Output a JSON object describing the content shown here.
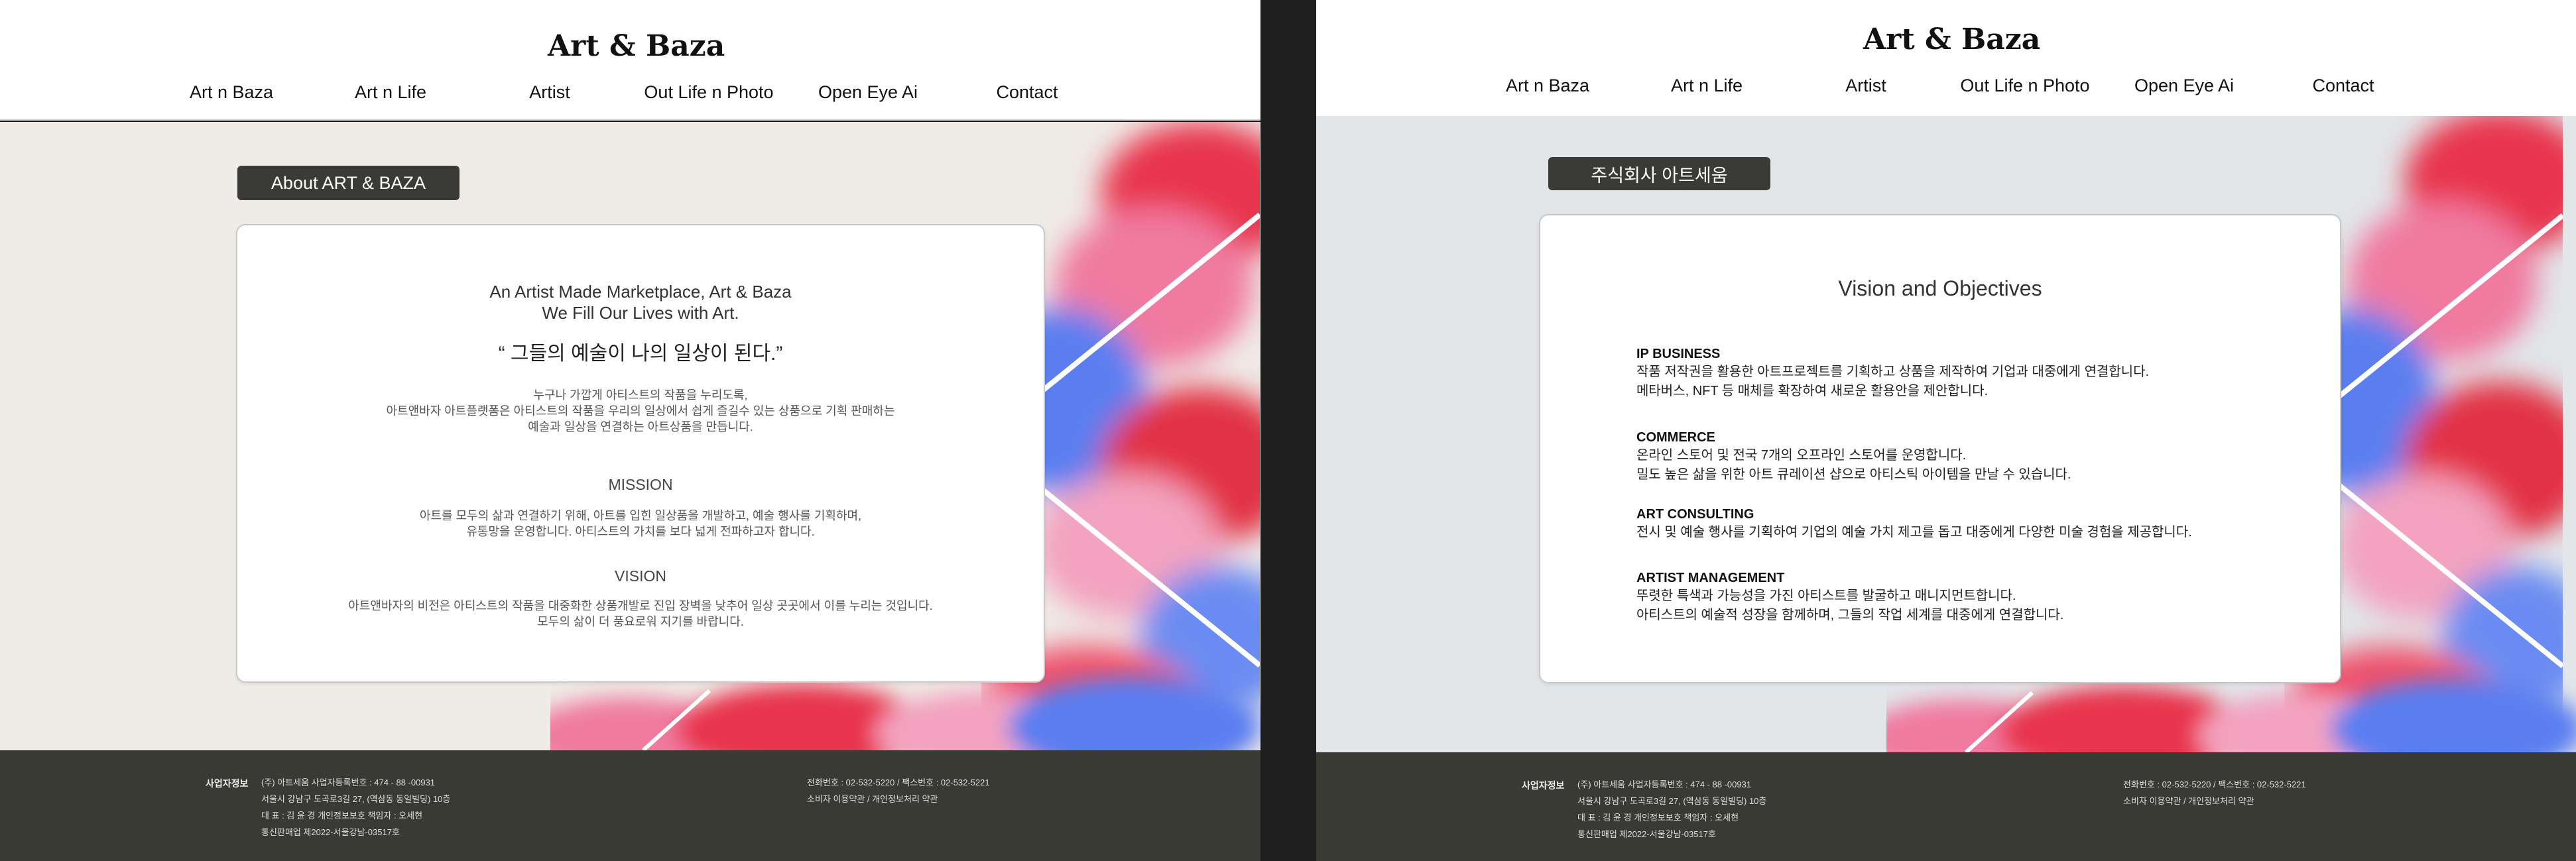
{
  "site": {
    "logo": "Art & Baza",
    "nav": [
      "Art n Baza",
      "Art n Life",
      "Artist",
      "Out Life n Photo",
      "Open Eye Ai",
      "Contact"
    ]
  },
  "left_page": {
    "badge": "About  ART & BAZA",
    "tagline": [
      "An Artist Made Marketplace, Art & Baza",
      "We Fill Our Lives with Art."
    ],
    "quote": "“ 그들의 예술이 나의 일상이 된다.”",
    "intro": [
      "누구나 가깝게 아티스트의 작품을 누리도록,",
      "아트앤바자 아트플랫폼은 아티스트의 작품을 우리의 일상에서 쉽게 즐길수 있는 상품으로 기획 판매하는",
      "예술과 일상을 연결하는 아트상품을 만듭니다."
    ],
    "mission_heading": "MISSION",
    "mission_text": [
      "아트를 모두의 삶과 연결하기 위해, 아트를 입힌 일상품을 개발하고, 예술 행사를 기획하며,",
      "유통망을 운영합니다. 아티스트의 가치를 보다 넓게 전파하고자 합니다."
    ],
    "vision_heading": "VISION",
    "vision_text": [
      "아트앤바자의 비전은 아티스트의 작품을 대중화한 상품개발로  진입 장벽을 낮추어 일상 곳곳에서 이를 누리는 것입니다.",
      "모두의 삶이 더 풍요로워 지기를 바랍니다."
    ]
  },
  "right_page": {
    "badge": "주식회사 아트세움",
    "title": "Vision and Objectives",
    "items": [
      {
        "title": "IP BUSINESS",
        "lines": [
          "작품 저작권을 활용한 아트프로젝트를 기획하고 상품을 제작하여 기업과 대중에게 연결합니다.",
          "메타버스, NFT 등 매체를 확장하여 새로운 활용안을 제안합니다."
        ]
      },
      {
        "title": "COMMERCE",
        "lines": [
          "온라인 스토어 및 전국 7개의 오프라인 스토어를 운영합니다.",
          "밀도 높은 삶을 위한 아트 큐레이션 샵으로 아티스틱 아이템을 만날 수 있습니다."
        ]
      },
      {
        "title": "ART CONSULTING",
        "lines": [
          "전시 및 예술 행사를 기획하여 기업의 예술 가치 제고를 돕고 대중에게 다양한 미술 경험을 제공합니다."
        ]
      },
      {
        "title": "ARTIST MANAGEMENT",
        "lines": [
          "뚜렷한 특색과 가능성을 가진 아티스트를 발굴하고 매니지먼트합니다.",
          "아티스트의 예술적 성장을 함께하며, 그들의 작업 세계를 대중에게 연결합니다."
        ]
      }
    ]
  },
  "footer": {
    "label": "사업자정보",
    "lines": [
      "(주) 아트세움      사업자등록번호 : 474 - 88 -00931",
      "서울시 강남구 도곡로3길 27, (역삼동 동일빌딩) 10층",
      "대 표 : 김 윤 경      개인정보보호 책임자 : 오세현",
      "통신판매업 제2022-서울강남-03517호"
    ],
    "right_lines": [
      "전화번호 : 02-532-5220   /   팩스번호 : 02-532-5221",
      "소비자 이용약관    /    개인정보처리 약관"
    ]
  },
  "colors": {
    "footer_bg": "#3a3a35",
    "badge_bg": "#3a3a36",
    "left_bg": "#efebe7",
    "right_bg": "#e2e6e9",
    "ink_red": "#e8344e",
    "ink_pink": "#f07aa0",
    "ink_blue": "#5a7ef0"
  }
}
